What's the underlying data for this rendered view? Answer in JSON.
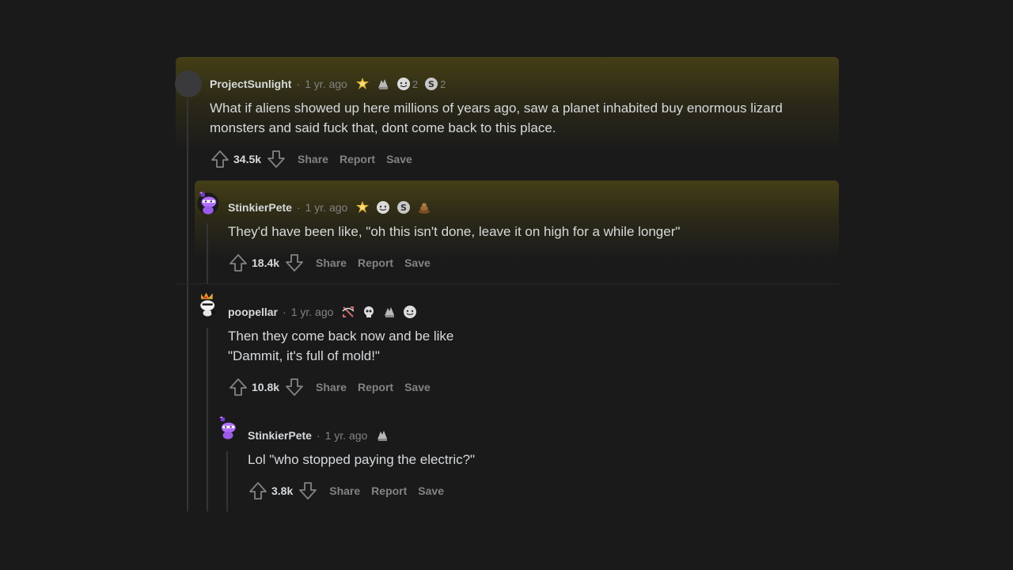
{
  "comments": [
    {
      "username": "ProjectSunlight",
      "separator": "·",
      "time": "1 yr. ago",
      "awards": [
        {
          "icon": "gold-award-icon",
          "color": "#e5b93b",
          "count": ""
        },
        {
          "icon": "silver-hands-award-icon",
          "color": "#b8b8b8",
          "count": ""
        },
        {
          "icon": "wholesome-award-icon",
          "color": "#dcdcdc",
          "count": "2"
        },
        {
          "icon": "silver-award-icon",
          "color": "#c8c8c8",
          "count": "2"
        }
      ],
      "body": [
        "What if aliens showed up here millions of years ago, saw a planet inhabited buy enormous lizard",
        "monsters and said fuck that, dont come back to this place."
      ],
      "score": "34.5k",
      "share": "Share",
      "report": "Report",
      "save": "Save"
    },
    {
      "username": "StinkierPete",
      "separator": "·",
      "time": "1 yr. ago",
      "awards": [
        {
          "icon": "gold-award-icon",
          "color": "#e5b93b",
          "count": ""
        },
        {
          "icon": "wholesome-award-icon",
          "color": "#dcdcdc",
          "count": ""
        },
        {
          "icon": "silver-award-icon",
          "color": "#c8c8c8",
          "count": ""
        },
        {
          "icon": "poop-award-icon",
          "color": "#9a6a3a",
          "count": ""
        }
      ],
      "body": [
        "They'd have been like, \"oh this isn't done, leave it on high for a while longer\""
      ],
      "score": "18.4k",
      "share": "Share",
      "report": "Report",
      "save": "Save"
    },
    {
      "username": "poopellar",
      "separator": "·",
      "time": "1 yr. ago",
      "awards": [
        {
          "icon": "bow-and-arrow-award-icon",
          "color": "#c86a6a",
          "count": ""
        },
        {
          "icon": "skull-award-icon",
          "color": "#dcdcdc",
          "count": ""
        },
        {
          "icon": "silver-hands-award-icon",
          "color": "#b8b8b8",
          "count": ""
        },
        {
          "icon": "wholesome-award-icon",
          "color": "#dcdcdc",
          "count": ""
        }
      ],
      "body": [
        "Then they come back now and be like",
        "\"Dammit, it's full of mold!\""
      ],
      "score": "10.8k",
      "share": "Share",
      "report": "Report",
      "save": "Save"
    },
    {
      "username": "StinkierPete",
      "separator": "·",
      "time": "1 yr. ago",
      "awards": [
        {
          "icon": "silver-hands-award-icon",
          "color": "#b8b8b8",
          "count": ""
        }
      ],
      "body": [
        "Lol \"who stopped paying the electric?\""
      ],
      "score": "3.8k",
      "share": "Share",
      "report": "Report",
      "save": "Save"
    }
  ],
  "colors": {
    "background": "#1a1a1b",
    "text": "#d7dadc",
    "meta": "#818384",
    "thread_line": "#343536"
  }
}
